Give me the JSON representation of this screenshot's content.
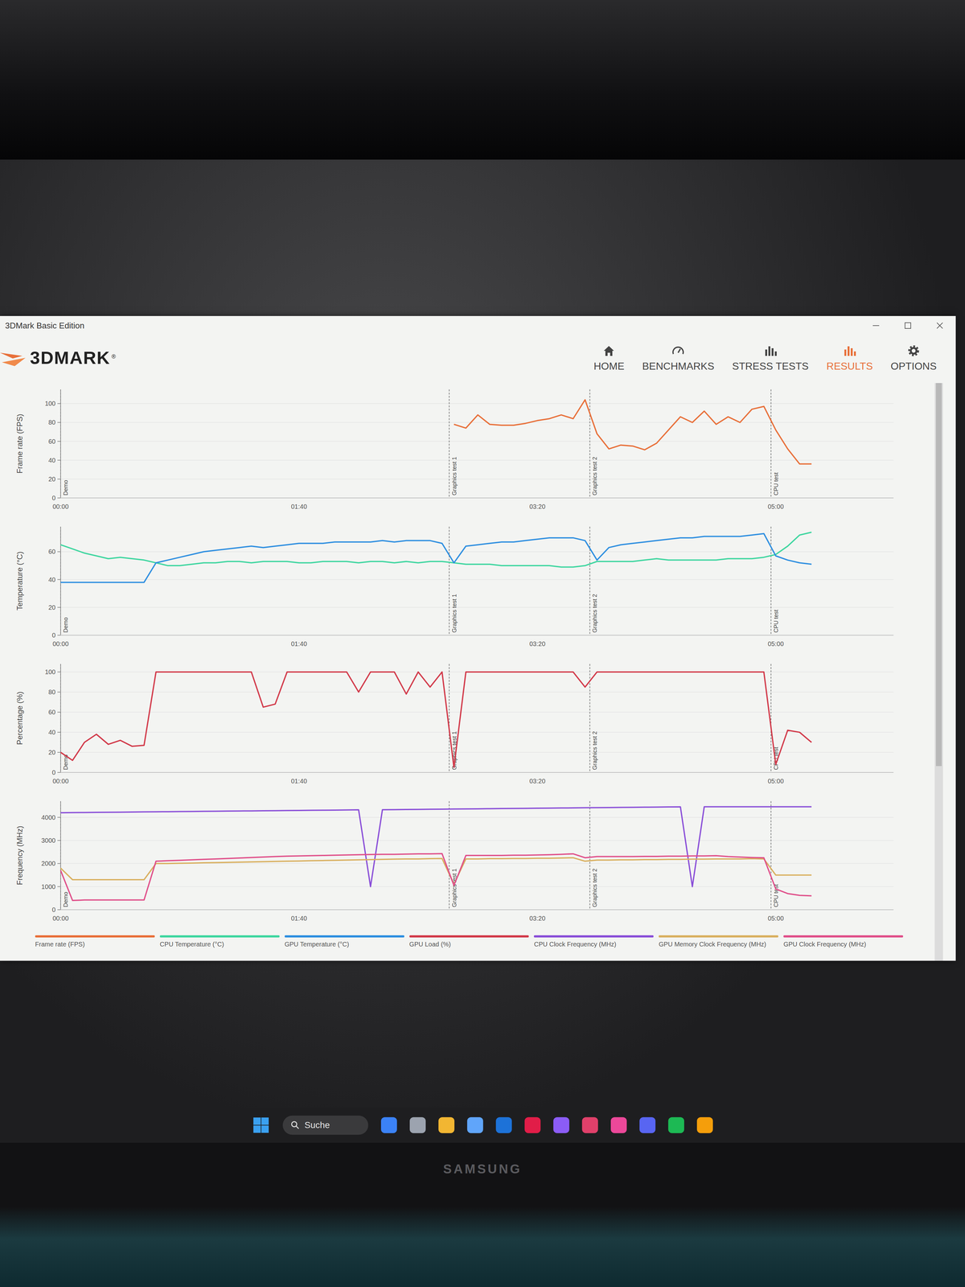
{
  "window": {
    "title": "3DMark Basic Edition"
  },
  "logo": {
    "text": "3DMARK",
    "mark": "®"
  },
  "nav": [
    {
      "label": "HOME",
      "selected": false
    },
    {
      "label": "BENCHMARKS",
      "selected": false
    },
    {
      "label": "STRESS TESTS",
      "selected": false
    },
    {
      "label": "RESULTS",
      "selected": true
    },
    {
      "label": "OPTIONS",
      "selected": false
    }
  ],
  "x_ticks": [
    "00:00",
    "01:40",
    "03:20",
    "05:00"
  ],
  "markers": [
    {
      "label": "Demo",
      "seconds": 0
    },
    {
      "label": "Graphics test 1",
      "seconds": 163
    },
    {
      "label": "Graphics test 2",
      "seconds": 222
    },
    {
      "label": "CPU test",
      "seconds": 298
    }
  ],
  "charts": [
    {
      "axis_label": "Frame rate (FPS)",
      "max": 115,
      "y_ticks": [
        "0",
        "20",
        "40",
        "60",
        "80",
        "100"
      ],
      "series": [
        {
          "label": "Frame rate (FPS)",
          "color": "#e8703a",
          "values": [
            null,
            null,
            null,
            null,
            null,
            null,
            null,
            null,
            null,
            null,
            null,
            null,
            null,
            null,
            null,
            null,
            null,
            null,
            null,
            null,
            null,
            null,
            null,
            null,
            null,
            null,
            null,
            null,
            null,
            null,
            null,
            null,
            null,
            78,
            74,
            88,
            78,
            77,
            77,
            79,
            82,
            84,
            88,
            84,
            104,
            68,
            52,
            56,
            55,
            51,
            58,
            72,
            86,
            80,
            92,
            78,
            86,
            80,
            94,
            97,
            72,
            52,
            36,
            36
          ]
        }
      ]
    },
    {
      "axis_label": "Temperature (°C)",
      "max": 78,
      "y_ticks": [
        "0",
        "20",
        "40",
        "60"
      ],
      "series": [
        {
          "label": "CPU Temperature (°C)",
          "color": "#3fd6a0",
          "values": [
            65,
            62,
            59,
            57,
            55,
            56,
            55,
            54,
            52,
            50,
            50,
            51,
            52,
            52,
            53,
            53,
            52,
            53,
            53,
            53,
            52,
            52,
            53,
            53,
            53,
            52,
            53,
            53,
            52,
            53,
            52,
            53,
            53,
            52,
            51,
            51,
            51,
            50,
            50,
            50,
            50,
            50,
            49,
            49,
            50,
            53,
            53,
            53,
            53,
            54,
            55,
            54,
            54,
            54,
            54,
            54,
            55,
            55,
            55,
            56,
            58,
            64,
            72,
            74
          ]
        },
        {
          "label": "GPU Temperature (°C)",
          "color": "#2f8fe0",
          "values": [
            38,
            38,
            38,
            38,
            38,
            38,
            38,
            38,
            52,
            54,
            56,
            58,
            60,
            61,
            62,
            63,
            64,
            63,
            64,
            65,
            66,
            66,
            66,
            67,
            67,
            67,
            67,
            68,
            67,
            68,
            68,
            68,
            66,
            52,
            64,
            65,
            66,
            67,
            67,
            68,
            69,
            70,
            70,
            70,
            68,
            54,
            63,
            65,
            66,
            67,
            68,
            69,
            70,
            70,
            71,
            71,
            71,
            71,
            72,
            73,
            57,
            54,
            52,
            51
          ]
        }
      ]
    },
    {
      "axis_label": "Percentage (%)",
      "max": 108,
      "y_ticks": [
        "0",
        "20",
        "40",
        "60",
        "80",
        "100"
      ],
      "series": [
        {
          "label": "GPU Load (%)",
          "color": "#d23a4a",
          "values": [
            20,
            12,
            30,
            38,
            28,
            32,
            26,
            27,
            100,
            100,
            100,
            100,
            100,
            100,
            100,
            100,
            100,
            65,
            68,
            100,
            100,
            100,
            100,
            100,
            100,
            80,
            100,
            100,
            100,
            78,
            100,
            85,
            100,
            5,
            100,
            100,
            100,
            100,
            100,
            100,
            100,
            100,
            100,
            100,
            85,
            100,
            100,
            100,
            100,
            100,
            100,
            100,
            100,
            100,
            100,
            100,
            100,
            100,
            100,
            100,
            8,
            42,
            40,
            30
          ]
        }
      ]
    },
    {
      "axis_label": "Frequency (MHz)",
      "max": 4700,
      "y_ticks": [
        "0",
        "1000",
        "2000",
        "3000",
        "4000"
      ],
      "series": [
        {
          "label": "CPU Clock Frequency (MHz)",
          "color": "#8a4fd8",
          "values": [
            4200,
            4205,
            4210,
            4215,
            4220,
            4225,
            4230,
            4235,
            4240,
            4245,
            4250,
            4255,
            4260,
            4265,
            4270,
            4275,
            4280,
            4285,
            4290,
            4295,
            4300,
            4305,
            4310,
            4315,
            4320,
            4325,
            1000,
            4330,
            4335,
            4340,
            4345,
            4350,
            4355,
            4360,
            4365,
            4370,
            4375,
            4380,
            4385,
            4390,
            4395,
            4400,
            4405,
            4410,
            4415,
            4420,
            4425,
            4430,
            4435,
            4440,
            4445,
            4450,
            4455,
            1000,
            4460,
            4460,
            4460,
            4460,
            4460,
            4460,
            4460,
            4460,
            4460,
            4460
          ]
        },
        {
          "label": "GPU Memory Clock Frequency (MHz)",
          "color": "#d9b060",
          "values": [
            1800,
            1300,
            1300,
            1300,
            1300,
            1300,
            1300,
            1300,
            2000,
            2000,
            2010,
            2020,
            2030,
            2040,
            2050,
            2060,
            2070,
            2080,
            2090,
            2100,
            2110,
            2120,
            2130,
            2140,
            2150,
            2160,
            2170,
            2180,
            2190,
            2200,
            2200,
            2210,
            2220,
            1100,
            2200,
            2200,
            2210,
            2210,
            2220,
            2220,
            2230,
            2230,
            2240,
            2250,
            2100,
            2150,
            2150,
            2160,
            2160,
            2170,
            2170,
            2180,
            2180,
            2190,
            2190,
            2200,
            2200,
            2200,
            2210,
            2200,
            1500,
            1500,
            1500,
            1500
          ]
        },
        {
          "label": "GPU Clock Frequency (MHz)",
          "color": "#e0508a",
          "values": [
            1700,
            400,
            420,
            420,
            420,
            420,
            420,
            420,
            2100,
            2120,
            2140,
            2160,
            2180,
            2200,
            2220,
            2240,
            2260,
            2280,
            2300,
            2320,
            2330,
            2340,
            2350,
            2360,
            2370,
            2380,
            2390,
            2400,
            2400,
            2410,
            2420,
            2420,
            2430,
            1050,
            2350,
            2350,
            2350,
            2350,
            2360,
            2360,
            2370,
            2380,
            2400,
            2420,
            2250,
            2300,
            2300,
            2300,
            2300,
            2310,
            2310,
            2320,
            2320,
            2330,
            2330,
            2340,
            2300,
            2280,
            2260,
            2250,
            900,
            700,
            620,
            600
          ]
        }
      ]
    }
  ],
  "taskbar": {
    "search_placeholder": "Suche",
    "apps": [
      {
        "color": "#3b82f6"
      },
      {
        "color": "#9ca3af"
      },
      {
        "color": "#f2b632"
      },
      {
        "color": "#60a5fa"
      },
      {
        "color": "#1d72d8"
      },
      {
        "color": "#e11d48"
      },
      {
        "color": "#8b5cf6"
      },
      {
        "color": "#e0406a"
      },
      {
        "color": "#ec4899"
      },
      {
        "color": "#5865f2"
      },
      {
        "color": "#1db954"
      },
      {
        "color": "#f59e0b"
      }
    ]
  },
  "bezel": {
    "brand": "SAMSUNG"
  }
}
